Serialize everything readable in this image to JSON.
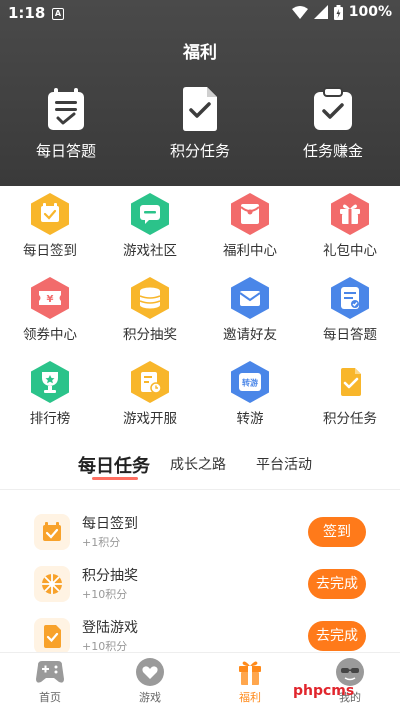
{
  "status_bar": {
    "time": "1:18",
    "notif_icon_letter": "A",
    "battery": "100%"
  },
  "header": {
    "title": "福利",
    "features": [
      {
        "label": "每日答题",
        "icon": "daily-quiz-icon"
      },
      {
        "label": "积分任务",
        "icon": "points-task-icon"
      },
      {
        "label": "任务赚金",
        "icon": "task-earn-icon"
      }
    ]
  },
  "grid": [
    {
      "label": "每日签到",
      "icon": "calendar-check-icon",
      "color": "#f8b62b"
    },
    {
      "label": "游戏社区",
      "icon": "chat-icon",
      "color": "#2bc38a"
    },
    {
      "label": "福利中心",
      "icon": "red-envelope-icon",
      "color": "#f26b6b"
    },
    {
      "label": "礼包中心",
      "icon": "gift-icon",
      "color": "#f26b6b"
    },
    {
      "label": "领券中心",
      "icon": "coupon-icon",
      "color": "#f26b6b"
    },
    {
      "label": "积分抽奖",
      "icon": "coin-stack-icon",
      "color": "#f8b62b"
    },
    {
      "label": "邀请好友",
      "icon": "invite-mail-icon",
      "color": "#4a86e8"
    },
    {
      "label": "每日答题",
      "icon": "quiz-icon",
      "color": "#4a86e8"
    },
    {
      "label": "排行榜",
      "icon": "trophy-icon",
      "color": "#2bc38a"
    },
    {
      "label": "游戏开服",
      "icon": "server-clock-icon",
      "color": "#f8b62b"
    },
    {
      "label": "转游",
      "icon": "transfer-game-icon",
      "color": "#4a86e8"
    },
    {
      "label": "积分任务",
      "icon": "points-task-icon",
      "color": "#f8b62b"
    }
  ],
  "tabs": [
    {
      "label": "每日任务"
    },
    {
      "label": "成长之路"
    },
    {
      "label": "平台活动"
    }
  ],
  "tasks": [
    {
      "title": "每日签到",
      "reward": "+1积分",
      "button": "签到",
      "icon": "calendar-check-icon"
    },
    {
      "title": "积分抽奖",
      "reward": "+10积分",
      "button": "去完成",
      "icon": "wheel-icon"
    },
    {
      "title": "登陆游戏",
      "reward": "+10积分",
      "button": "去完成",
      "icon": "login-game-icon"
    }
  ],
  "bottom_nav": [
    {
      "label": "首页",
      "icon": "gamepad-icon"
    },
    {
      "label": "游戏",
      "icon": "heart-game-icon"
    },
    {
      "label": "福利",
      "icon": "gift-box-icon"
    },
    {
      "label": "我的",
      "icon": "profile-icon"
    }
  ],
  "watermark": "phpcms",
  "colors": {
    "accent_orange": "#ff7a1a",
    "tab_underline": "#ff6f61",
    "header_bg": "#3d3d3d"
  }
}
